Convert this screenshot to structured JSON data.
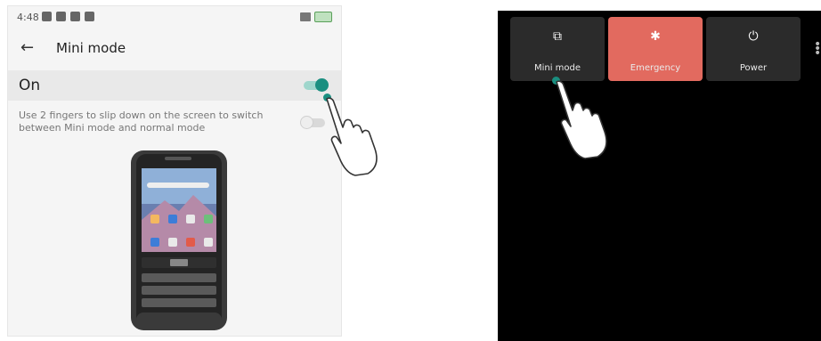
{
  "left_screen": {
    "status_time": "4:48",
    "back_icon": "arrow-left-icon",
    "title": "Mini mode",
    "on_label": "On",
    "description": "Use 2 fingers to slip down on the screen to switch between Mini mode and normal mode"
  },
  "right_screen": {
    "tiles": [
      {
        "label": "Mini mode",
        "icon": "copy-icon"
      },
      {
        "label": "Emergency",
        "icon": "asterisk-icon"
      },
      {
        "label": "Power",
        "icon": "power-icon"
      }
    ],
    "more_icon": "more-vertical-icon"
  },
  "colors": {
    "accent_teal": "#1a8f80",
    "emergency": "#e26a5f",
    "tile_bg": "#2b2b2b"
  }
}
